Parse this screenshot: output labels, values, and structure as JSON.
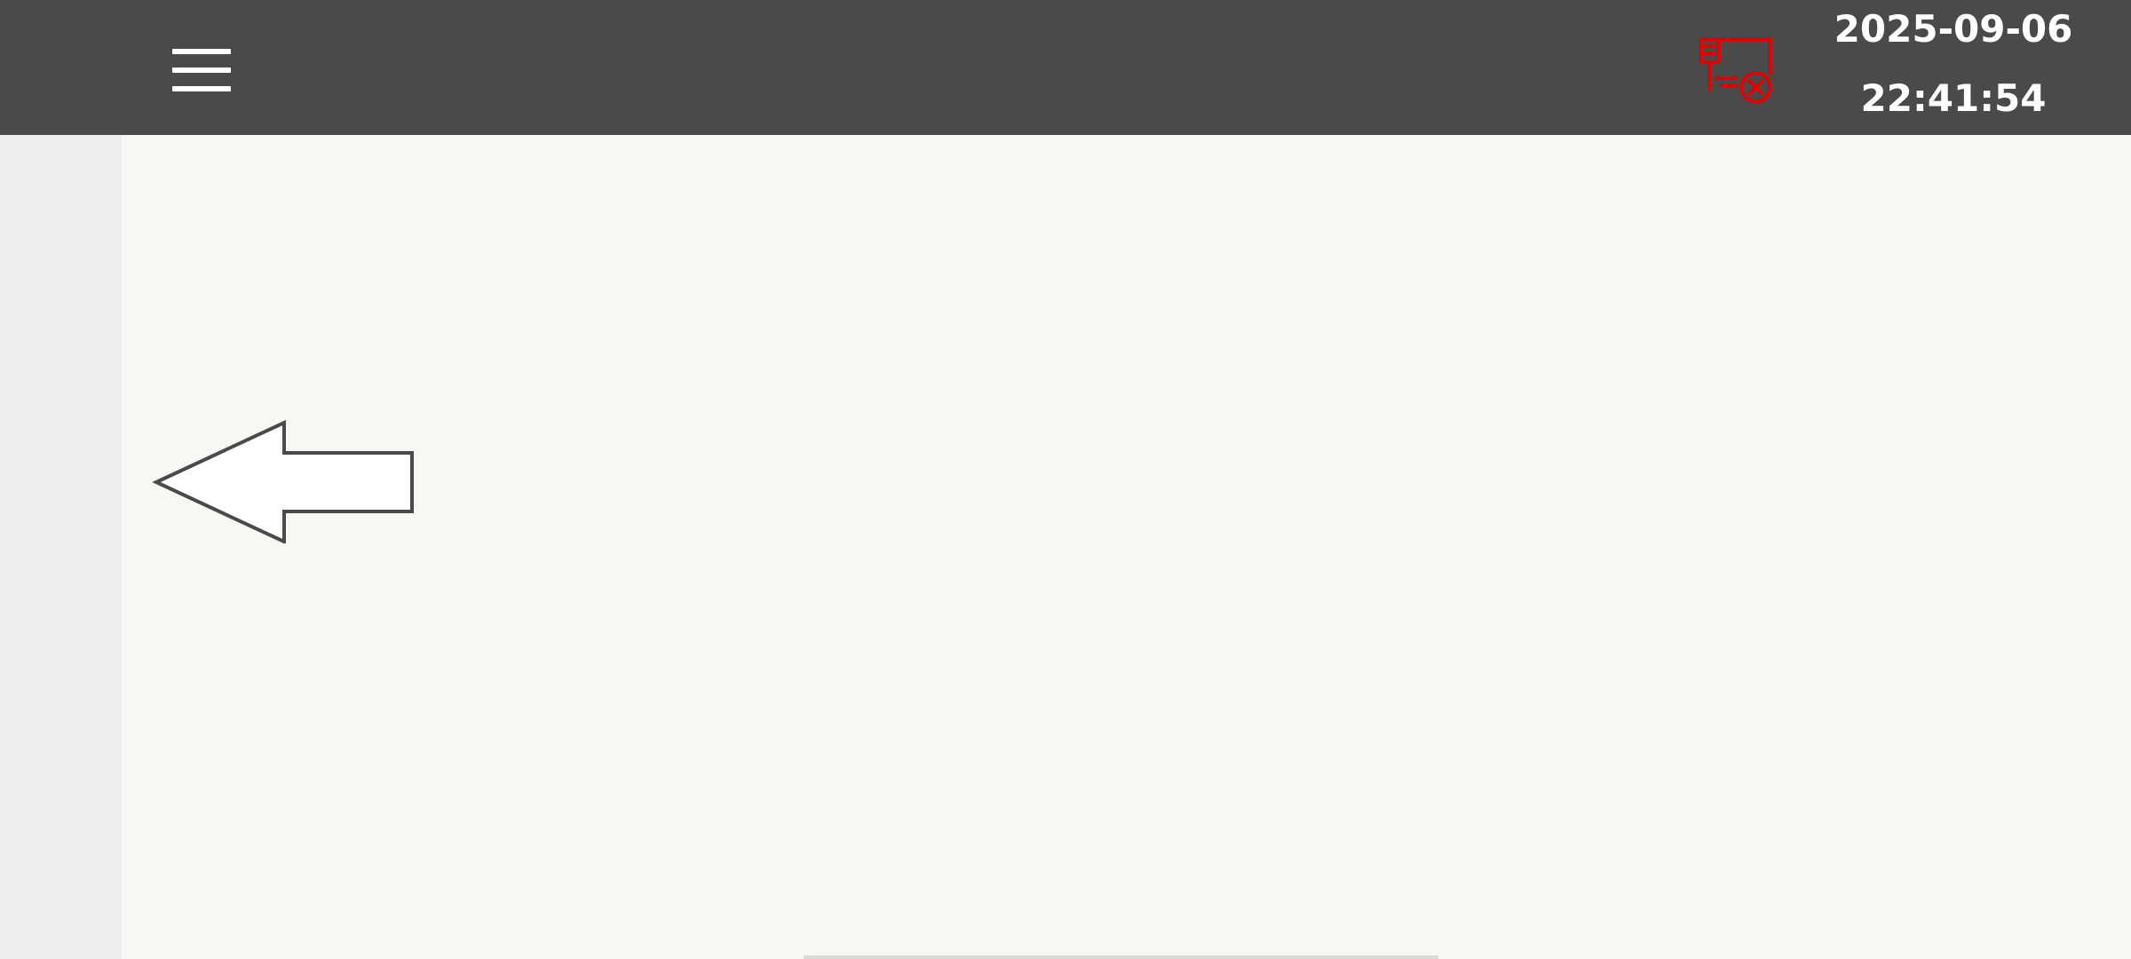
{
  "header": {
    "menu_icon": "hamburger-menu-icon",
    "connection_status_icon": "disconnected-plug-icon",
    "connection_status_color": "#e00000",
    "date": "2025-09-06",
    "time": "22:41:54"
  },
  "main": {
    "back_icon": "left-arrow-icon"
  },
  "colors": {
    "topbar": "#4b4a4b",
    "content_bg": "#f8f7f3",
    "side_strip": "#efedee"
  }
}
